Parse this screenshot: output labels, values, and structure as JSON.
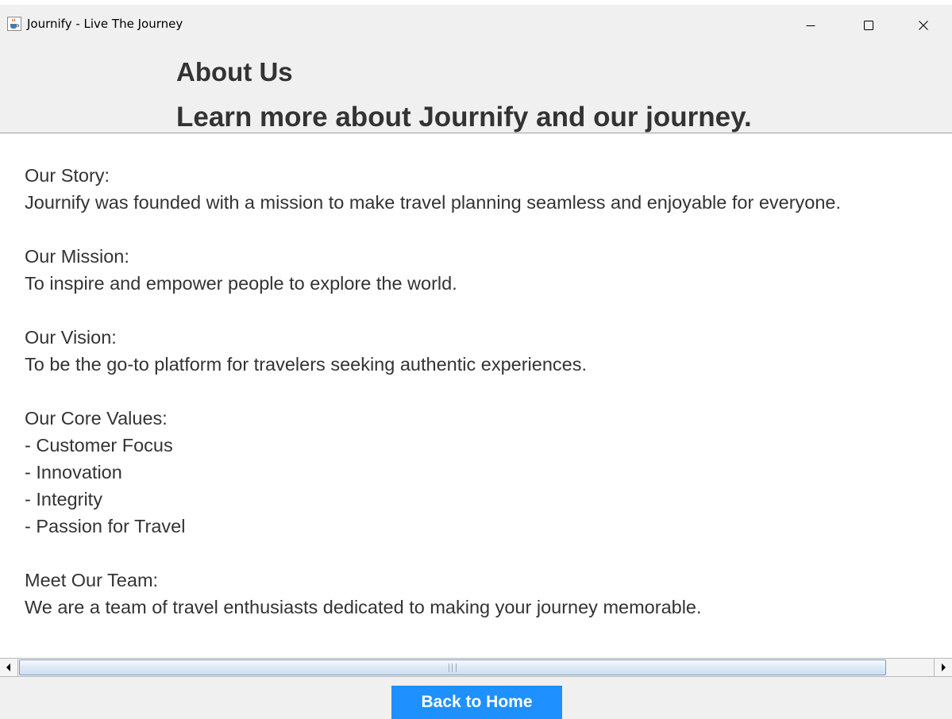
{
  "window": {
    "title": "Journify - Live The Journey",
    "icon": "java-coffee-cup-icon",
    "controls": [
      "minimize-icon",
      "maximize-icon",
      "close-icon"
    ]
  },
  "header": {
    "title": "About Us",
    "subtitle": "Learn more about Journify and our journey."
  },
  "content": {
    "text": "Our Story:\nJournify was founded with a mission to make travel planning seamless and enjoyable for everyone.\n\nOur Mission:\nTo inspire and empower people to explore the world.\n\nOur Vision:\nTo be the go-to platform for travelers seeking authentic experiences.\n\nOur Core Values:\n- Customer Focus\n- Innovation\n- Integrity\n- Passion for Travel\n\nMeet Our Team:\nWe are a team of travel enthusiasts dedicated to making your journey memorable."
  },
  "footer": {
    "back_label": "Back to Home"
  },
  "colors": {
    "accent": "#1e90ff",
    "heading_text": "#333333",
    "window_bg": "#f0f0f0",
    "content_bg": "#ffffff"
  }
}
